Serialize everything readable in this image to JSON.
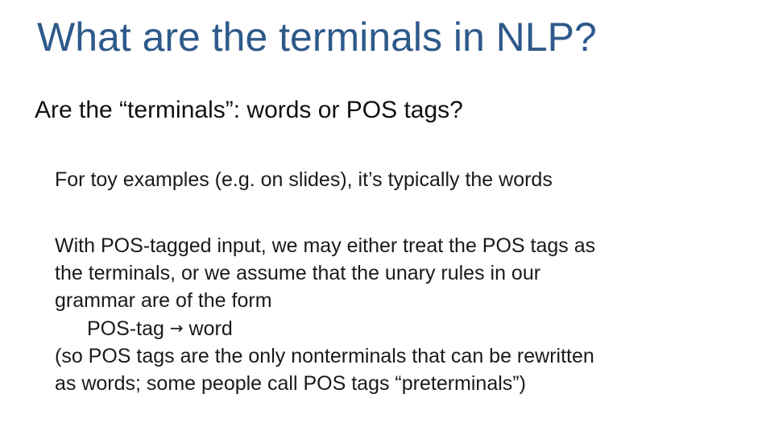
{
  "slide": {
    "title": "What are the terminals in NLP?",
    "subtitle": "Are the “terminals”: words or POS tags?",
    "paragraph1": "For toy examples (e.g. on slides), it’s typically the words",
    "paragraph2": {
      "line1": "With POS-tagged input, we may either treat the POS tags as",
      "line2": "the terminals, or we assume that the unary rules in our",
      "line3": "grammar are of the form",
      "rule_lhs": "POS-tag",
      "rule_arrow": "→",
      "rule_rhs": "word",
      "line5": "(so POS tags are the only nonterminals that can be rewritten",
      "line6": "as words; some people call POS tags “preterminals”)"
    }
  },
  "colors": {
    "title": "#2e5a8a",
    "text": "#1a1a1a",
    "background": "#ffffff"
  }
}
